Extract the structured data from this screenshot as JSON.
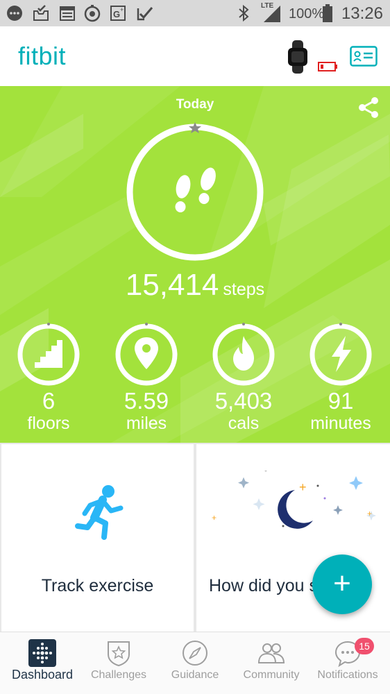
{
  "status_bar": {
    "battery_percent": "100%",
    "time": "13:26",
    "network": "LTE",
    "icons": [
      "chat-bubble-icon",
      "inbox-check-icon",
      "calendar-icon",
      "timer-icon",
      "google-plus-icon",
      "checkmark-icon",
      "bluetooth-icon",
      "signal-icon",
      "battery-icon"
    ]
  },
  "app_bar": {
    "logo": "fitbit",
    "device_battery_low": true
  },
  "hero": {
    "title": "Today",
    "steps": {
      "value": "15,414",
      "unit": "steps"
    },
    "stats": [
      {
        "value": "6",
        "unit": "floors",
        "icon": "stairs-icon"
      },
      {
        "value": "5.59",
        "unit": "miles",
        "icon": "location-pin-icon"
      },
      {
        "value": "5,403",
        "unit": "cals",
        "icon": "flame-icon"
      },
      {
        "value": "91",
        "unit": "minutes",
        "icon": "lightning-icon"
      }
    ],
    "background_color": "#a3e23c"
  },
  "tiles": [
    {
      "label": "Track exercise",
      "icon": "running-person-icon"
    },
    {
      "label": "How did you sleep?",
      "icon": "moon-stars-icon"
    }
  ],
  "fab": {
    "label": "+"
  },
  "bottom_nav": {
    "items": [
      {
        "label": "Dashboard",
        "icon": "dashboard-icon",
        "active": true
      },
      {
        "label": "Challenges",
        "icon": "challenges-shield-icon",
        "active": false
      },
      {
        "label": "Guidance",
        "icon": "compass-icon",
        "active": false
      },
      {
        "label": "Community",
        "icon": "community-people-icon",
        "active": false
      },
      {
        "label": "Notifications",
        "icon": "notifications-chat-icon",
        "active": false,
        "badge": "15"
      }
    ]
  },
  "colors": {
    "accent": "#00b0b9",
    "hero_green": "#a3e23c",
    "badge": "#f0506e",
    "battery_warning": "#e02020"
  }
}
